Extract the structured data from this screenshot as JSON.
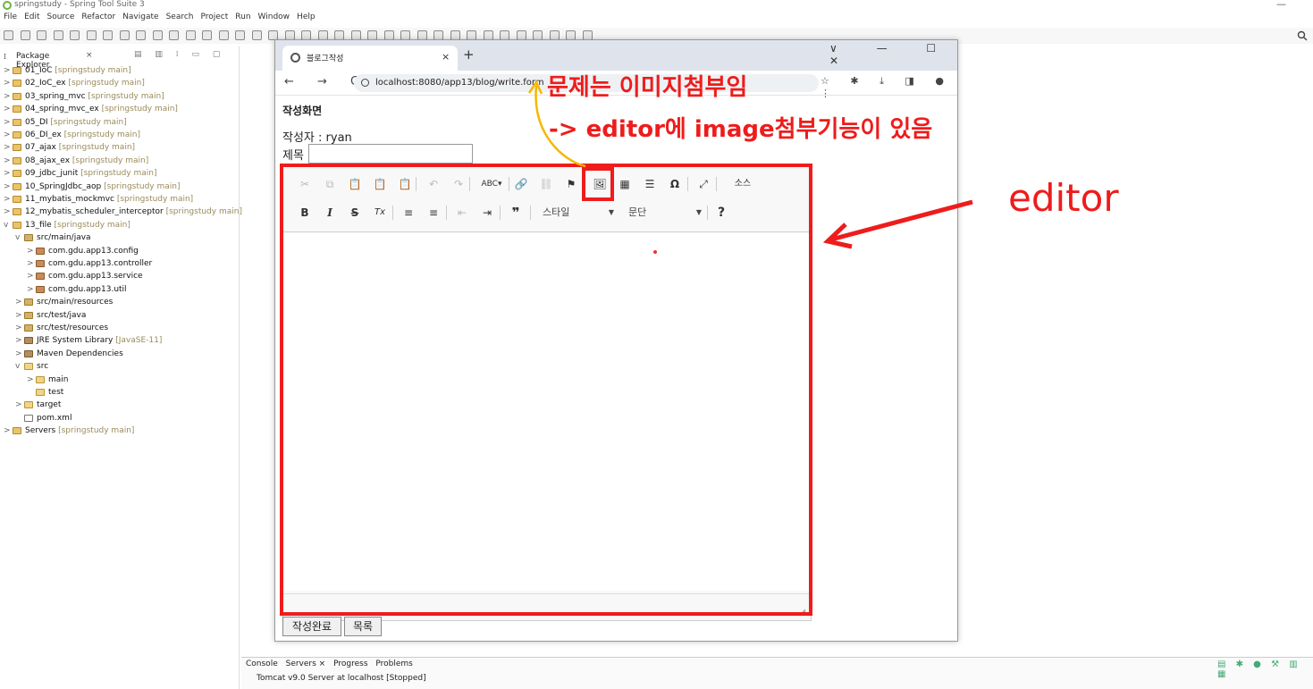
{
  "window": {
    "title": "springstudy - Spring Tool Suite 3",
    "minimize": "—"
  },
  "menu": [
    "File",
    "Edit",
    "Source",
    "Refactor",
    "Navigate",
    "Search",
    "Project",
    "Run",
    "Window",
    "Help"
  ],
  "package_explorer": {
    "tab_label": "Package Explorer",
    "close": "×",
    "items": [
      {
        "name": "01_IoC",
        "sub": "[springstudy main]",
        "indent": 0,
        "icon": "proj",
        "chev": ">"
      },
      {
        "name": "02_IoC_ex",
        "sub": "[springstudy main]",
        "indent": 0,
        "icon": "proj",
        "chev": ">"
      },
      {
        "name": "03_spring_mvc",
        "sub": "[springstudy main]",
        "indent": 0,
        "icon": "proj",
        "chev": ">"
      },
      {
        "name": "04_spring_mvc_ex",
        "sub": "[springstudy main]",
        "indent": 0,
        "icon": "proj",
        "chev": ">"
      },
      {
        "name": "05_DI",
        "sub": "[springstudy main]",
        "indent": 0,
        "icon": "proj",
        "chev": ">"
      },
      {
        "name": "06_DI_ex",
        "sub": "[springstudy main]",
        "indent": 0,
        "icon": "proj",
        "chev": ">"
      },
      {
        "name": "07_ajax",
        "sub": "[springstudy main]",
        "indent": 0,
        "icon": "proj",
        "chev": ">"
      },
      {
        "name": "08_ajax_ex",
        "sub": "[springstudy main]",
        "indent": 0,
        "icon": "proj",
        "chev": ">"
      },
      {
        "name": "09_jdbc_junit",
        "sub": "[springstudy main]",
        "indent": 0,
        "icon": "proj",
        "chev": ">"
      },
      {
        "name": "10_SpringJdbc_aop",
        "sub": "[springstudy main]",
        "indent": 0,
        "icon": "proj",
        "chev": ">"
      },
      {
        "name": "11_mybatis_mockmvc",
        "sub": "[springstudy main]",
        "indent": 0,
        "icon": "proj",
        "chev": ">"
      },
      {
        "name": "12_mybatis_scheduler_interceptor",
        "sub": "[springstudy main]",
        "indent": 0,
        "icon": "proj",
        "chev": ">"
      },
      {
        "name": "13_file",
        "sub": "[springstudy main]",
        "indent": 0,
        "icon": "proj",
        "chev": "v"
      },
      {
        "name": "src/main/java",
        "sub": "",
        "indent": 1,
        "icon": "src",
        "chev": "v"
      },
      {
        "name": "com.gdu.app13.config",
        "sub": "",
        "indent": 2,
        "icon": "pkg",
        "chev": ">"
      },
      {
        "name": "com.gdu.app13.controller",
        "sub": "",
        "indent": 2,
        "icon": "pkg",
        "chev": ">"
      },
      {
        "name": "com.gdu.app13.service",
        "sub": "",
        "indent": 2,
        "icon": "pkg",
        "chev": ">"
      },
      {
        "name": "com.gdu.app13.util",
        "sub": "",
        "indent": 2,
        "icon": "pkg",
        "chev": ">"
      },
      {
        "name": "src/main/resources",
        "sub": "",
        "indent": 1,
        "icon": "src",
        "chev": ">"
      },
      {
        "name": "src/test/java",
        "sub": "",
        "indent": 1,
        "icon": "src",
        "chev": ">"
      },
      {
        "name": "src/test/resources",
        "sub": "",
        "indent": 1,
        "icon": "src",
        "chev": ">"
      },
      {
        "name": "JRE System Library",
        "sub": "[JavaSE-11]",
        "indent": 1,
        "icon": "lib",
        "chev": ">"
      },
      {
        "name": "Maven Dependencies",
        "sub": "",
        "indent": 1,
        "icon": "lib",
        "chev": ">"
      },
      {
        "name": "src",
        "sub": "",
        "indent": 1,
        "icon": "folder",
        "chev": "v"
      },
      {
        "name": "main",
        "sub": "",
        "indent": 2,
        "icon": "folder",
        "chev": ">"
      },
      {
        "name": "test",
        "sub": "",
        "indent": 2,
        "icon": "folder",
        "chev": ""
      },
      {
        "name": "target",
        "sub": "",
        "indent": 1,
        "icon": "folder",
        "chev": ">"
      },
      {
        "name": "pom.xml",
        "sub": "",
        "indent": 1,
        "icon": "file",
        "chev": ""
      },
      {
        "name": "Servers",
        "sub": "[springstudy main]",
        "indent": 0,
        "icon": "proj",
        "chev": ">"
      }
    ]
  },
  "bottom": {
    "tabs": [
      "Console",
      "Servers ×",
      "Progress",
      "Problems"
    ],
    "server": "Tomcat v9.0 Server at localhost  [Stopped]"
  },
  "browser": {
    "tab_title": "블로그작성",
    "tab_close": "×",
    "new_tab": "+",
    "win_controls": "∨ — ☐ ✕",
    "nav": "← → C",
    "url": "localhost:8080/app13/blog/write.form",
    "right_icons": "☆ ✱ ⤓ ◨ ● ⋮"
  },
  "page": {
    "heading": "작성화면",
    "author": "작성자 : ryan",
    "title_label": "제목",
    "save_button": "작성완료",
    "list_button": "목록"
  },
  "editor": {
    "row1": [
      "✂",
      "⧉",
      "📋",
      "📋",
      "📋",
      "↶",
      "↷",
      "ABC▾",
      "🔗",
      "⛓",
      "⚑",
      "🖼",
      "▦",
      "☰",
      "Ω",
      "⤢",
      "소스"
    ],
    "row2": [
      "B",
      "I",
      "S",
      "Tx",
      "≡",
      "≡",
      "⇤",
      "⇥",
      "❞"
    ],
    "style_combo": "스타일",
    "format_combo": "문단",
    "help": "?"
  },
  "annotations": {
    "line1": "문제는 이미지첨부임",
    "line2": "-> editor에 image첨부기능이 있음",
    "label": "editor",
    "color": "#ee1c1c",
    "arrow_color": "#f5b800"
  }
}
